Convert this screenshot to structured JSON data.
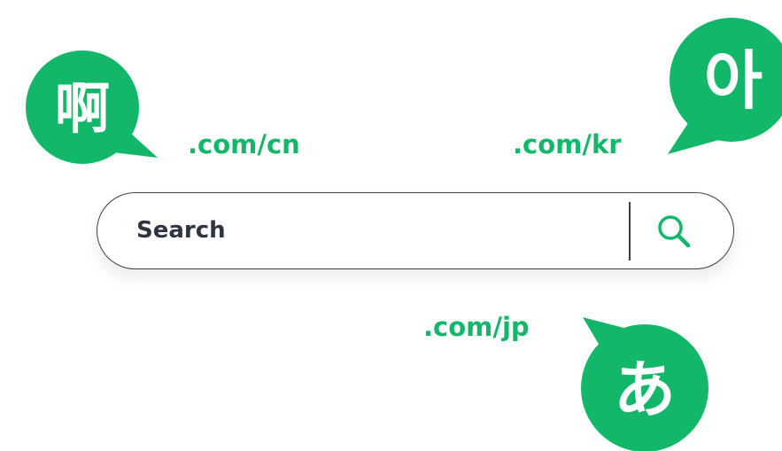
{
  "colors": {
    "accent": "#12b76a",
    "bubble_text": "#ffffff",
    "search_border": "#3b3f45",
    "search_text": "#2e3440"
  },
  "bubbles": {
    "chinese": {
      "glyph": "啊"
    },
    "korean": {
      "glyph": "아"
    },
    "japanese": {
      "glyph": "あ"
    }
  },
  "domains": {
    "cn": ".com/cn",
    "kr": ".com/kr",
    "jp": ".com/jp"
  },
  "search": {
    "placeholder": "Search",
    "icon": "search-icon"
  }
}
